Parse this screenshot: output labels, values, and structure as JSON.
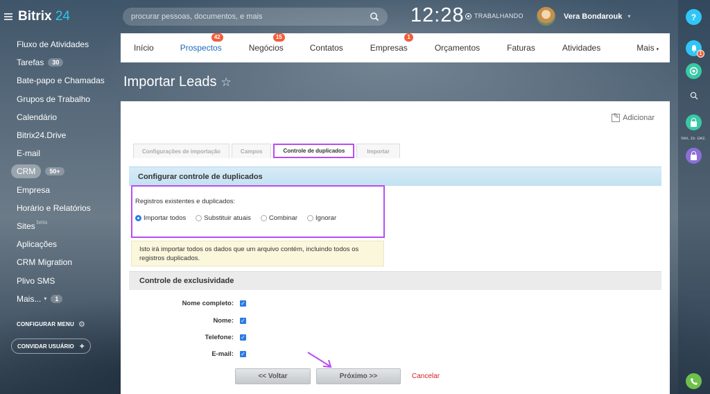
{
  "app": {
    "name": "Bitrix",
    "name_num": "24"
  },
  "sidebar": {
    "items": [
      {
        "label": "Fluxo de Atividades"
      },
      {
        "label": "Tarefas",
        "count": "30"
      },
      {
        "label": "Bate-papo e Chamadas"
      },
      {
        "label": "Grupos de Trabalho"
      },
      {
        "label": "Calendário"
      },
      {
        "label": "Bitrix24.Drive"
      },
      {
        "label": "E-mail"
      },
      {
        "label": "CRM",
        "count": "50+"
      },
      {
        "label": "Empresa"
      },
      {
        "label": "Horário e Relatórios"
      },
      {
        "label": "Sites",
        "sup": "beta"
      },
      {
        "label": "Aplicações"
      },
      {
        "label": "CRM Migration"
      },
      {
        "label": "Plivo SMS"
      },
      {
        "label": "Mais...",
        "count": "1"
      }
    ],
    "config_menu": "CONFIGURAR MENU",
    "invite_button": "CONVIDAR USUÁRIO"
  },
  "header": {
    "search_placeholder": "procurar pessoas, documentos, e mais",
    "clock": "12:28",
    "work_status": "TRABALHANDO",
    "user_name": "Vera Bondarouk"
  },
  "tabs": [
    {
      "label": "Início"
    },
    {
      "label": "Prospectos",
      "badge": "42",
      "active": true
    },
    {
      "label": "Negócios",
      "badge": "15"
    },
    {
      "label": "Contatos"
    },
    {
      "label": "Empresas",
      "badge": "1"
    },
    {
      "label": "Orçamentos"
    },
    {
      "label": "Faturas"
    },
    {
      "label": "Atividades"
    },
    {
      "label": "Mais"
    }
  ],
  "page_title": "Importar Leads",
  "panel": {
    "add_link": "Adicionar",
    "steps": [
      {
        "label": "Configurações de importação"
      },
      {
        "label": "Campos"
      },
      {
        "label": "Controle de duplicados",
        "active": true
      },
      {
        "label": "Importar"
      }
    ],
    "dup_section_title": "Configurar controle de duplicados",
    "dup_label": "Registros existentes e duplicados:",
    "radio_options": [
      {
        "label": "Importar todos",
        "selected": true
      },
      {
        "label": "Substituir atuais"
      },
      {
        "label": "Combinar"
      },
      {
        "label": "Ignorar"
      }
    ],
    "notice": "Isto irá importar todos os dados que um arquivo contém, incluindo todos os registros duplicados.",
    "exclusivity_title": "Controle de exclusividade",
    "fields": [
      {
        "label": "Nome completo:",
        "checked": true
      },
      {
        "label": "Nome:",
        "checked": true
      },
      {
        "label": "Telefone:",
        "checked": true
      },
      {
        "label": "E-mail:",
        "checked": true
      }
    ],
    "back_button": "<< Voltar",
    "next_button": "Próximo >>",
    "cancel_link": "Cancelar"
  },
  "rightbar": {
    "help": "?",
    "notifications_count": "1",
    "date_label": "Sex, 15. Dez."
  },
  "colors": {
    "accent": "#2fc6f6",
    "active_tab": "#1a6bba",
    "badge": "#f35d3a",
    "highlight": "#b84cf2"
  }
}
